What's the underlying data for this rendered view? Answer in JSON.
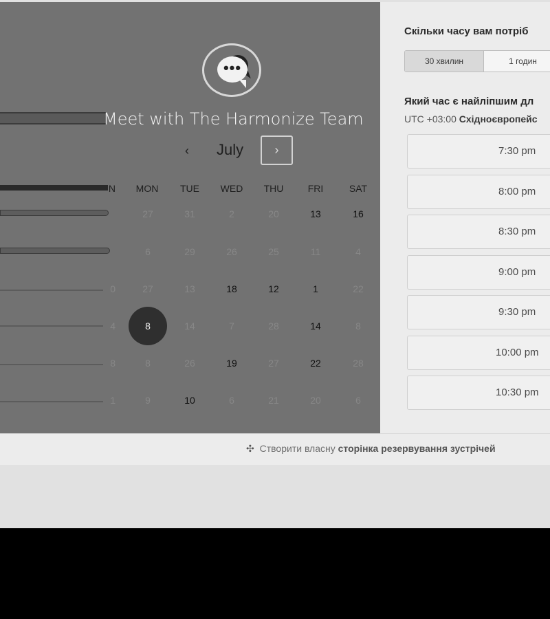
{
  "calendar": {
    "title": "Meet with The Harmonize Team",
    "month": "July",
    "prev_icon": "‹",
    "next_icon": "›",
    "weekdays": [
      "N",
      "MON",
      "TUE",
      "WED",
      "THU",
      "FRI",
      "SAT"
    ],
    "rows": [
      [
        "",
        "27",
        "31",
        "2",
        "20",
        "13",
        "16"
      ],
      [
        "",
        "6",
        "29",
        "26",
        "25",
        "11",
        "4"
      ],
      [
        "0",
        "27",
        "13",
        "18",
        "12",
        "1",
        "22"
      ],
      [
        "4",
        "8",
        "14",
        "7",
        "28",
        "14",
        "8"
      ],
      [
        "8",
        "8",
        "26",
        "19",
        "27",
        "22",
        "28"
      ],
      [
        "1",
        "9",
        "10",
        "6",
        "21",
        "20",
        "6"
      ]
    ],
    "active": [
      [
        false,
        false,
        false,
        false,
        false,
        true,
        true
      ],
      [
        false,
        false,
        false,
        false,
        false,
        false,
        false
      ],
      [
        false,
        false,
        false,
        true,
        true,
        true,
        false
      ],
      [
        false,
        true,
        false,
        false,
        false,
        true,
        false
      ],
      [
        false,
        false,
        false,
        true,
        false,
        true,
        false
      ],
      [
        false,
        false,
        true,
        false,
        false,
        false,
        false
      ]
    ],
    "selected": {
      "row": 3,
      "col": 1
    }
  },
  "booking": {
    "duration_heading": "Скільки часу вам потріб",
    "durations": [
      "30 хвилин",
      "1 годин"
    ],
    "selected_duration": "30 хвилин",
    "time_heading": "Який час є найліпшим дл",
    "tz_prefix": "UTC +03:00",
    "tz_name": "Східноєвропейс",
    "slots": [
      "7:30 pm",
      "8:00 pm",
      "8:30 pm",
      "9:00 pm",
      "9:30 pm",
      "10:00 pm",
      "10:30 pm"
    ]
  },
  "footer": {
    "icon": "hubspot-sprocket-icon",
    "text_plain": "Створити власну",
    "text_bold": "сторінка резервування зустрічей"
  },
  "colors": {
    "overlay": "#727272",
    "selected_day": "#2f2f2f",
    "panel_bg": "#ececec"
  }
}
